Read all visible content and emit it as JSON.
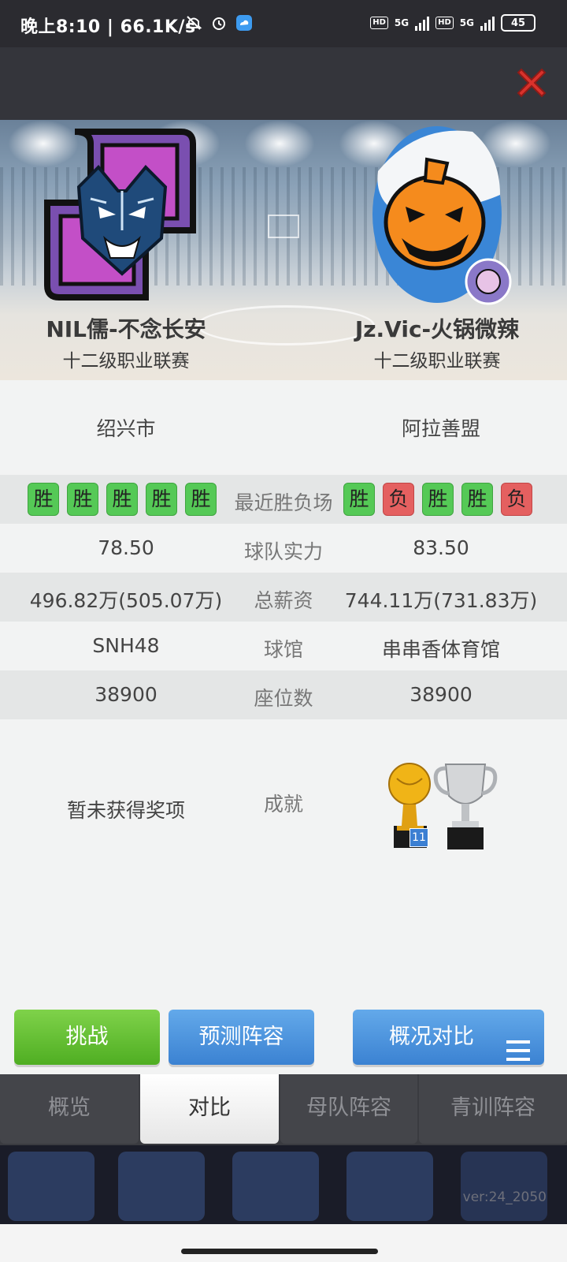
{
  "status_bar": {
    "time_speed": "晚上8:10 | 66.1K/s",
    "network_left": "5G",
    "network_right": "5G",
    "hd": "HD",
    "battery": "45"
  },
  "home_team": {
    "name": "NIL儒-不念长安",
    "league": "十二级职业联赛",
    "city": "绍兴市",
    "recent": [
      "胜",
      "胜",
      "胜",
      "胜",
      "胜"
    ],
    "strength": "78.50",
    "salary": "496.82万(505.07万)",
    "arena": "SNH48",
    "seats": "38900",
    "achievements": "暂未获得奖项"
  },
  "away_team": {
    "name": "Jz.Vic-火锅微辣",
    "league": "十二级职业联赛",
    "city": "阿拉善盟",
    "recent": [
      "胜",
      "负",
      "胜",
      "胜",
      "负"
    ],
    "strength": "83.50",
    "salary": "744.11万(731.83万)",
    "arena": "串串香体育馆",
    "seats": "38900",
    "trophy_count": "11"
  },
  "labels": {
    "recent": "最近胜负场",
    "strength": "球队实力",
    "salary": "总薪资",
    "arena": "球馆",
    "seats": "座位数",
    "achievements": "成就"
  },
  "buttons": {
    "challenge": "挑战",
    "predict": "预测阵容",
    "overview_compare": "概况对比"
  },
  "tabs": [
    "概览",
    "对比",
    "母队阵容",
    "青训阵容"
  ],
  "active_tab": "对比",
  "version": "ver:24_2050",
  "colors": {
    "win": "#55c956",
    "loss": "#e46060",
    "close": "#d9322c",
    "green_button": "#5cbf2a",
    "blue_button": "#4a90e2"
  }
}
